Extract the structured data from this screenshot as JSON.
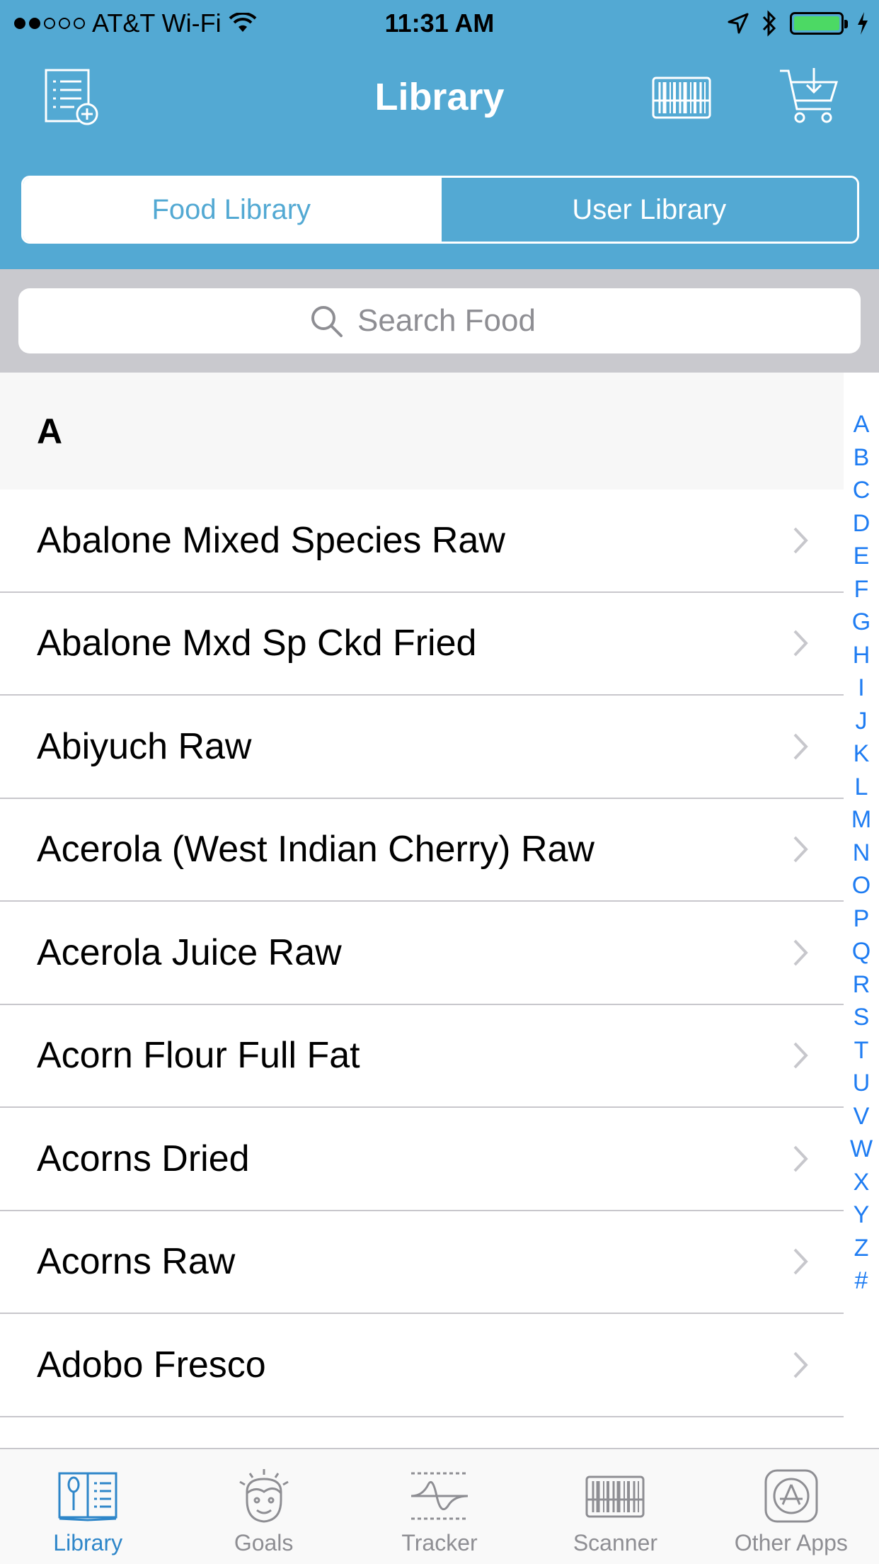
{
  "status_bar": {
    "carrier": "AT&T Wi-Fi",
    "time": "11:31 AM",
    "battery_level": 1.0,
    "signal_bars": 2
  },
  "nav": {
    "title": "Library",
    "left_icon": "new-list-icon",
    "right_icons": [
      "barcode-icon",
      "cart-download-icon"
    ]
  },
  "segments": {
    "food_library": "Food Library",
    "user_library": "User Library",
    "selected": "Food Library"
  },
  "search": {
    "placeholder": "Search Food"
  },
  "section": {
    "letter": "A"
  },
  "items": [
    "Abalone Mixed Species Raw",
    "Abalone Mxd Sp Ckd Fried",
    "Abiyuch Raw",
    "Acerola (West Indian Cherry) Raw",
    "Acerola Juice Raw",
    "Acorn Flour Full Fat",
    "Acorns Dried",
    "Acorns Raw",
    "Adobo Fresco"
  ],
  "index_letters": [
    "A",
    "B",
    "C",
    "D",
    "E",
    "F",
    "G",
    "H",
    "I",
    "J",
    "K",
    "L",
    "M",
    "N",
    "O",
    "P",
    "Q",
    "R",
    "S",
    "T",
    "U",
    "V",
    "W",
    "X",
    "Y",
    "Z",
    "#"
  ],
  "tabs": [
    {
      "label": "Library",
      "icon": "library-book-icon",
      "active": true
    },
    {
      "label": "Goals",
      "icon": "goals-face-icon",
      "active": false
    },
    {
      "label": "Tracker",
      "icon": "tracker-wave-icon",
      "active": false
    },
    {
      "label": "Scanner",
      "icon": "scanner-barcode-icon",
      "active": false
    },
    {
      "label": "Other Apps",
      "icon": "app-store-icon",
      "active": false
    }
  ],
  "colors": {
    "header": "#53A9D3",
    "index": "#1E7CF2",
    "tab_active": "#2E86C9",
    "tab_inactive": "#8E8E93"
  }
}
